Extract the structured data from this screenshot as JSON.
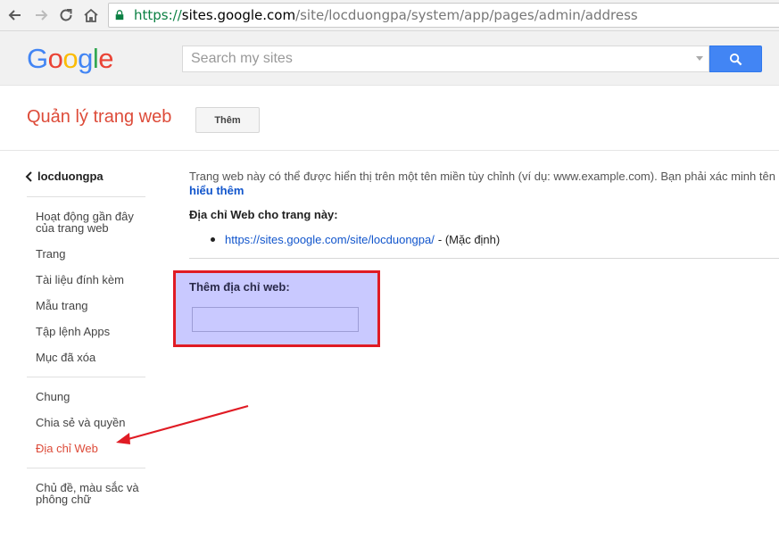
{
  "browser": {
    "url_scheme": "https://",
    "url_host": "sites.google.com",
    "url_path": "/site/locduongpa/system/app/pages/admin/address"
  },
  "header": {
    "logo_letters": [
      "G",
      "o",
      "o",
      "g",
      "l",
      "e"
    ],
    "search_placeholder": "Search my sites",
    "search_button_icon": "search-icon"
  },
  "title_row": {
    "title": "Quản lý trang web",
    "add_button": "Thêm"
  },
  "sidebar": {
    "site_name": "locduongpa",
    "group1": [
      {
        "label": "Hoạt động gần đây của trang web"
      },
      {
        "label": "Trang"
      },
      {
        "label": "Tài liệu đính kèm"
      },
      {
        "label": "Mẫu trang"
      },
      {
        "label": "Tập lệnh Apps"
      },
      {
        "label": "Mục đã xóa"
      }
    ],
    "group2": [
      {
        "label": "Chung"
      },
      {
        "label": "Chia sẻ và quyền"
      },
      {
        "label": "Địa chỉ Web"
      }
    ],
    "group3": [
      {
        "label": "Chủ đề, màu sắc và phông chữ"
      }
    ]
  },
  "main": {
    "intro_text": "Trang web này có thể được hiển thị trên một tên miền tùy chỉnh (ví dụ: www.example.com). Bạn phải xác minh tên",
    "learn_more": "hiểu thêm",
    "web_heading": "Địa chỉ Web cho trang này:",
    "address_link": "https://sites.google.com/site/locduongpa/",
    "address_suffix": "- (Mặc định)",
    "add_panel_label": "Thêm địa chỉ web:",
    "add_panel_value": ""
  },
  "colors": {
    "accent_red": "#dd4b39",
    "link_blue": "#1155cc",
    "search_blue": "#4285f4",
    "highlight_panel": "#c9c9ff",
    "annotation_red": "#e01b24"
  }
}
